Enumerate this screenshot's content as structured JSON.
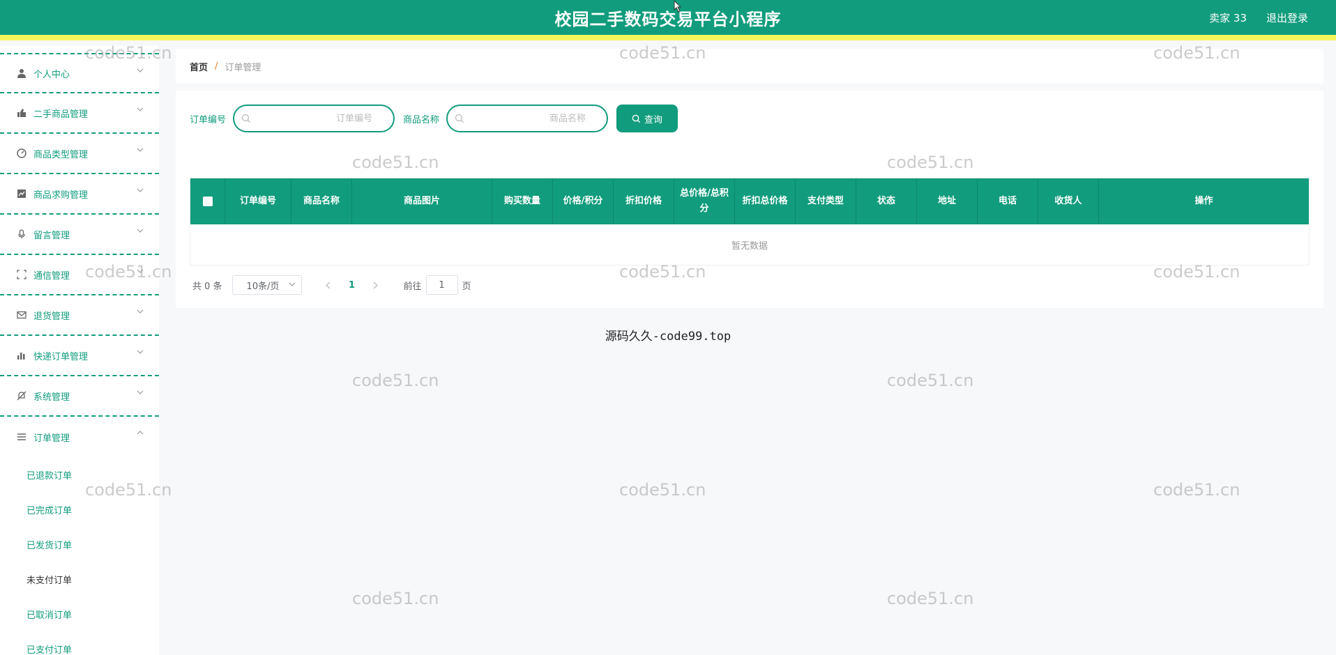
{
  "header": {
    "title": "校园二手数码交易平台小程序",
    "user": "卖家 33",
    "logout": "退出登录"
  },
  "sidebar": {
    "items": [
      {
        "label": "个人中心",
        "icon": "user-icon"
      },
      {
        "label": "二手商品管理",
        "icon": "thumb-icon"
      },
      {
        "label": "商品类型管理",
        "icon": "gauge-icon"
      },
      {
        "label": "商品求购管理",
        "icon": "chart-icon"
      },
      {
        "label": "留言管理",
        "icon": "mic-icon"
      },
      {
        "label": "通信管理",
        "icon": "fullscreen-icon"
      },
      {
        "label": "退货管理",
        "icon": "mail-icon"
      },
      {
        "label": "快递订单管理",
        "icon": "bar-chart-icon"
      },
      {
        "label": "系统管理",
        "icon": "bell-off-icon"
      },
      {
        "label": "订单管理",
        "icon": "menu-icon"
      }
    ],
    "submenu": [
      "已退款订单",
      "已完成订单",
      "已发货订单",
      "未支付订单",
      "已取消订单",
      "已支付订单"
    ]
  },
  "breadcrumb": {
    "home": "首页",
    "sep": "/",
    "current": "订单管理"
  },
  "search": {
    "order_no_label": "订单编号",
    "order_no_placeholder": "订单编号",
    "order_no_value": "",
    "product_label": "商品名称",
    "product_placeholder": "商品名称",
    "product_value": "",
    "button": "查询"
  },
  "table": {
    "columns": [
      "订单编号",
      "商品名称",
      "商品图片",
      "购买数量",
      "价格/积分",
      "折扣价格",
      "总价格/总积分",
      "折扣总价格",
      "支付类型",
      "状态",
      "地址",
      "电话",
      "收货人",
      "操作"
    ],
    "empty_text": "暂无数据"
  },
  "pagination": {
    "total": "共 0 条",
    "page_size": "10条/页",
    "current_page": "1",
    "goto_label": "前往",
    "goto_value": "1",
    "goto_suffix": "页"
  },
  "center_text": "源码久久-code99.top",
  "watermark": "code51.cn",
  "colors": {
    "primary": "#119c7d",
    "accent_bar": "#f4f55b"
  }
}
